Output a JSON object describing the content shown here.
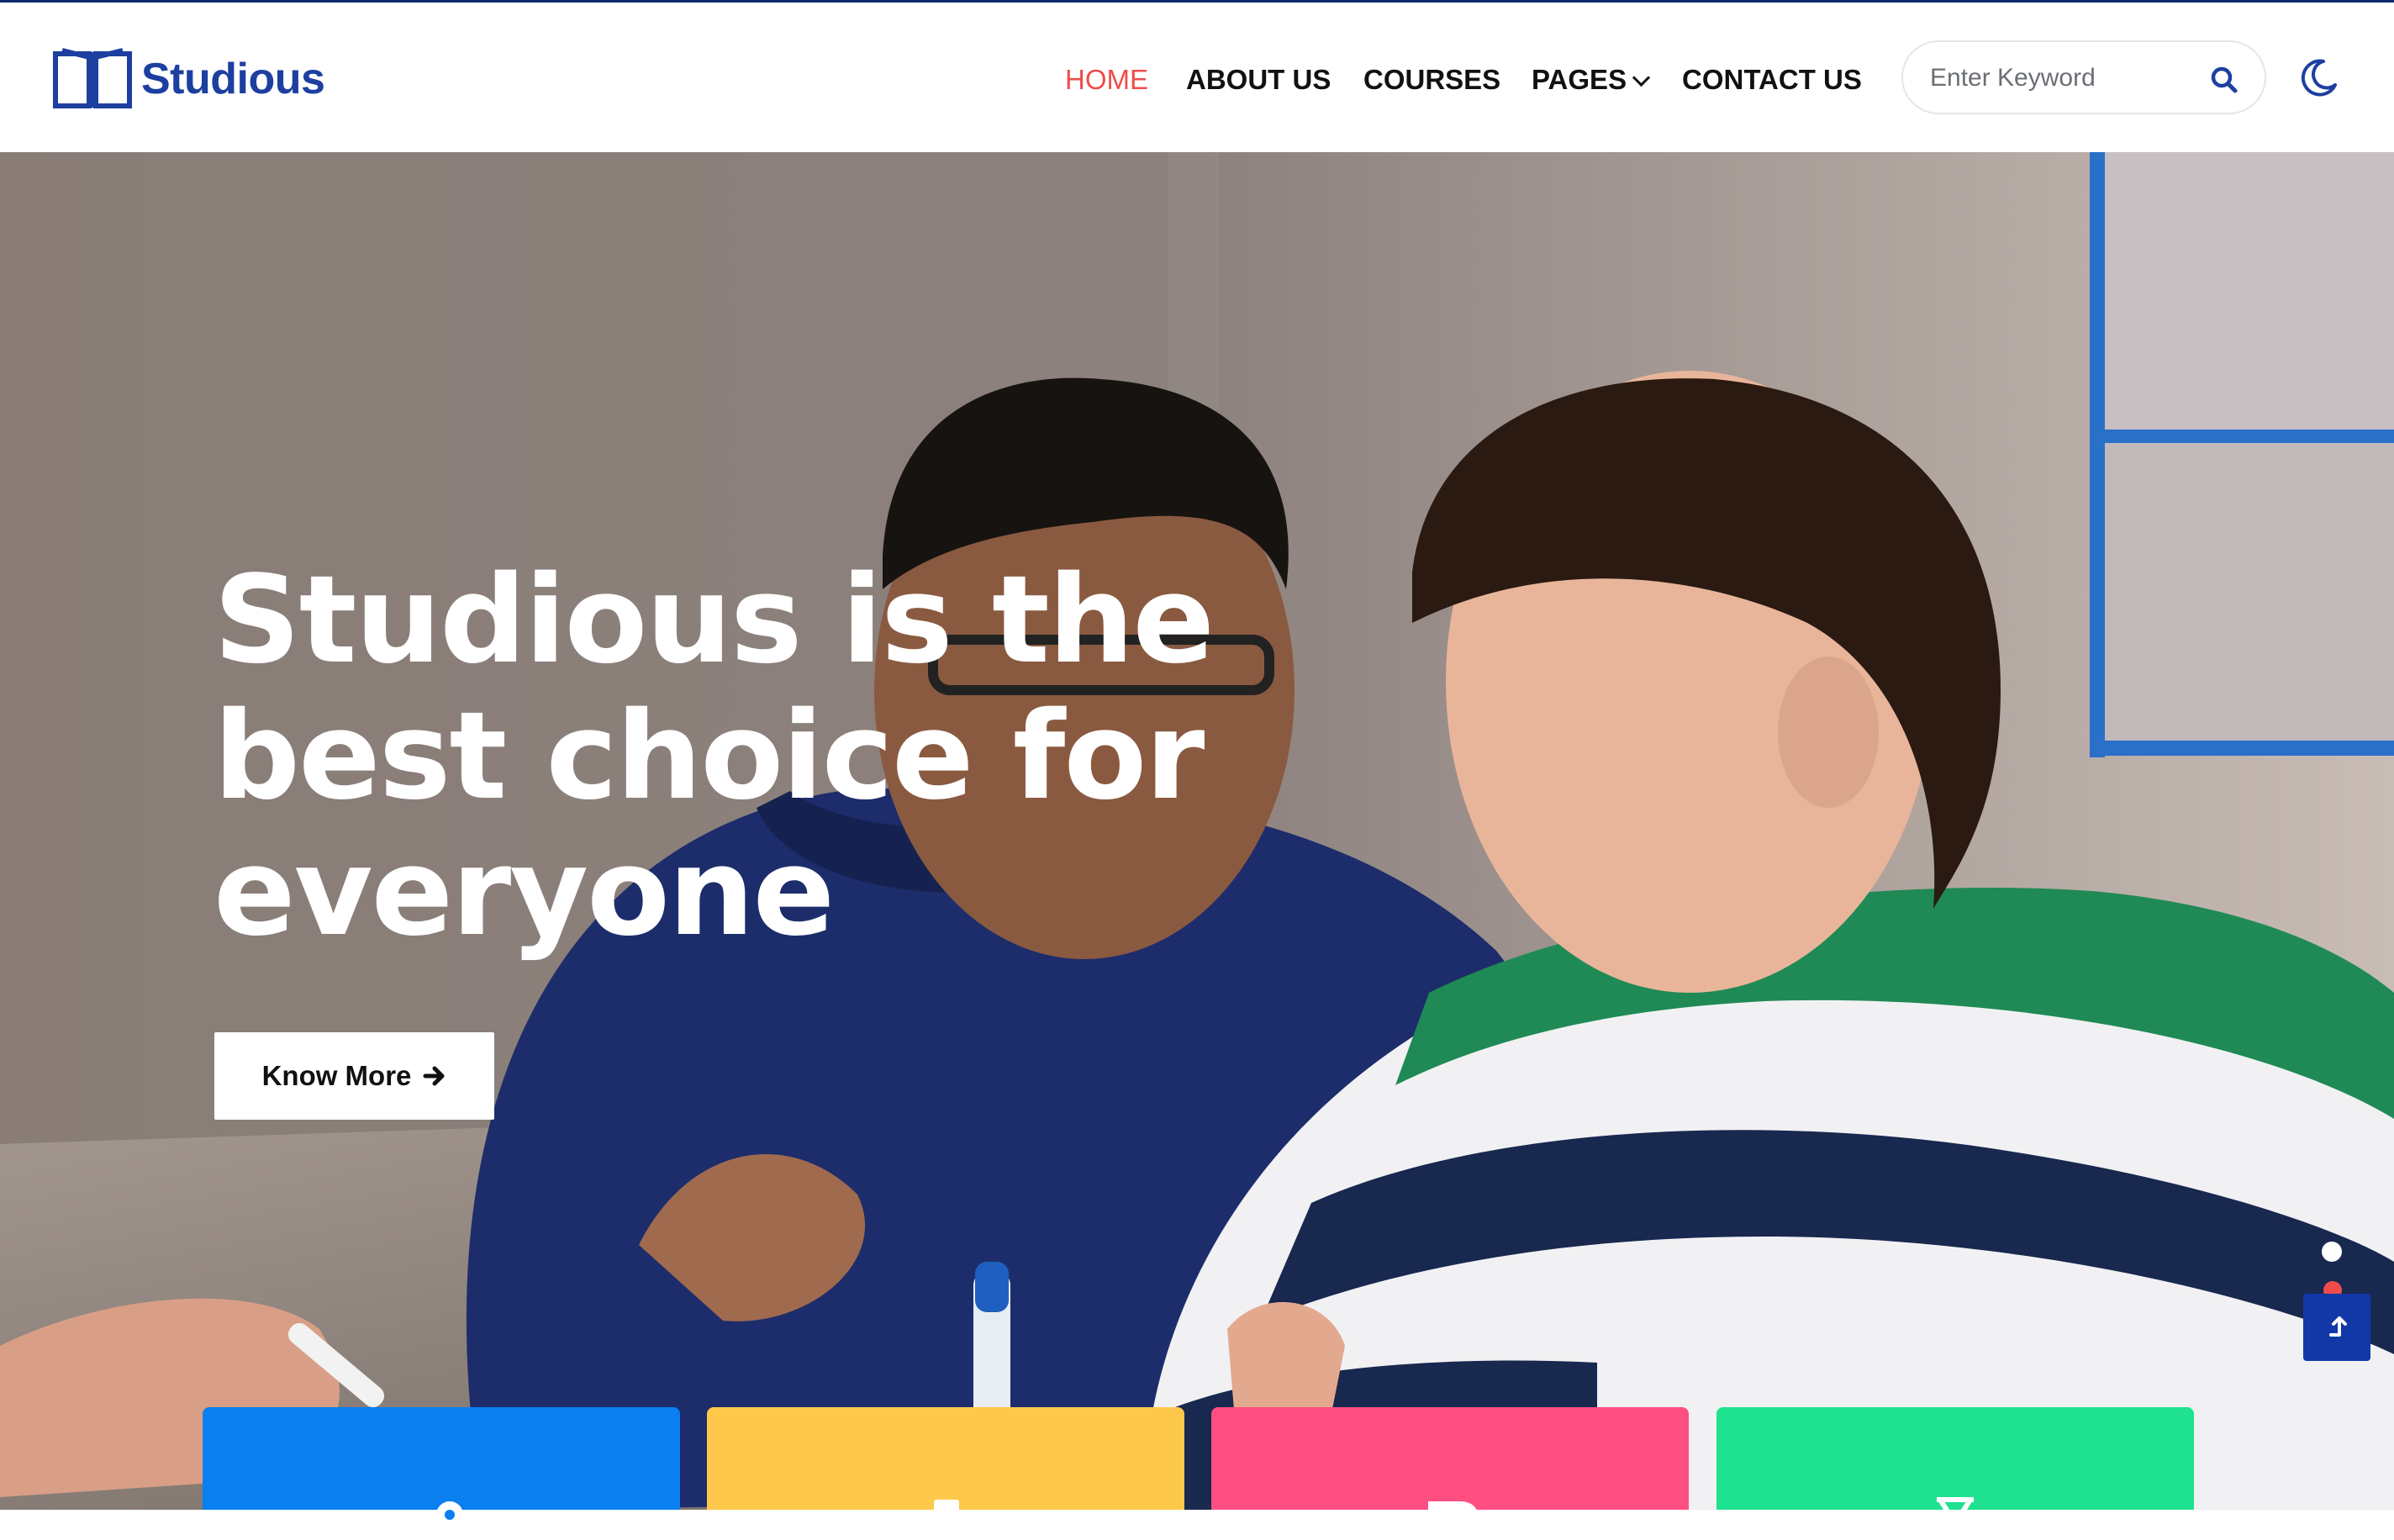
{
  "brand": {
    "name": "Studious",
    "logo_icon": "open-book-icon",
    "color": "#1d3fa0"
  },
  "nav": {
    "items": [
      {
        "label": "HOME",
        "active": true
      },
      {
        "label": "ABOUT US",
        "active": false
      },
      {
        "label": "COURSES",
        "active": false
      },
      {
        "label": "PAGES",
        "active": false,
        "has_dropdown": true
      },
      {
        "label": "CONTACT US",
        "active": false
      }
    ],
    "active_color": "#ee4d4b"
  },
  "search": {
    "placeholder": "Enter Keyword",
    "icon": "search-icon"
  },
  "theme_toggle": {
    "icon": "moon-icon"
  },
  "hero": {
    "title": "Studious is the best choice for everyone",
    "button_label": "Know More",
    "button_icon": "arrow-right-icon"
  },
  "slider": {
    "slides": 2,
    "active_index": 0
  },
  "scroll_top": {
    "icon": "arrow-up-icon",
    "color": "#1238a8"
  },
  "features": [
    {
      "color": "#0a7ff0",
      "icon": "gears-icon"
    },
    {
      "color": "#fec84a",
      "icon": "book-icon"
    },
    {
      "color": "#fe4e82",
      "icon": "document-icon"
    },
    {
      "color": "#1ee28f",
      "icon": "hourglass-icon"
    }
  ]
}
